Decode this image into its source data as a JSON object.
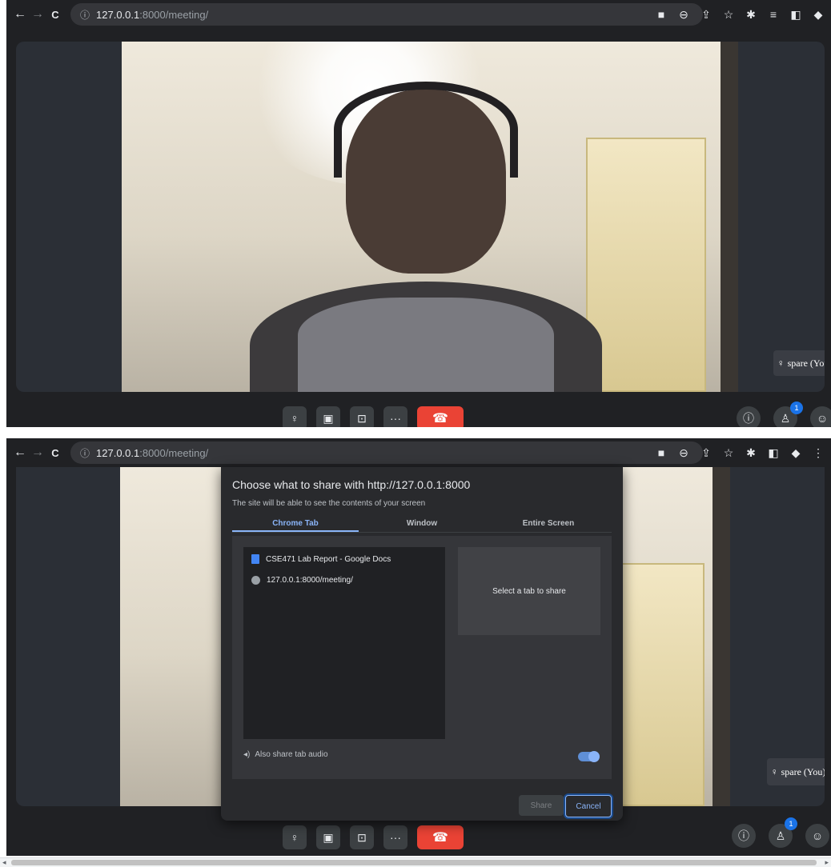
{
  "browser": {
    "url_host": "127.0.0.1",
    "url_rest": ":8000/meeting/"
  },
  "icons": {
    "back": "←",
    "forward": "→",
    "reload": "C",
    "info": "ⓘ",
    "camera": "■",
    "zoom": "⊖",
    "share": "⇪",
    "star": "☆",
    "extensions": "✱",
    "reading_list": "≡",
    "side_panel": "◧",
    "profile": "◆",
    "menu": "⋮",
    "mic": "♀",
    "video": "▣",
    "present": "⊡",
    "more": "···",
    "end_call": "☎",
    "meeting_info": "ⓘ",
    "people": "♙",
    "chat": "☺"
  },
  "meeting": {
    "self_label": "spare (You)",
    "participant_count": "1"
  },
  "dialog": {
    "title": "Choose what to share with http://127.0.0.1:8000",
    "subtitle": "The site will be able to see the contents of your screen",
    "tabs": [
      {
        "label": "Chrome Tab",
        "active": true
      },
      {
        "label": "Window",
        "active": false
      },
      {
        "label": "Entire Screen",
        "active": false
      }
    ],
    "items": [
      {
        "label": "CSE471 Lab Report - Google Docs",
        "icon": "docs-icon"
      },
      {
        "label": "127.0.0.1:8000/meeting/",
        "icon": "globe-icon"
      }
    ],
    "preview_text": "Select a tab to share",
    "audio_label": "Also share tab audio",
    "audio_enabled": true,
    "share_label": "Share",
    "cancel_label": "Cancel"
  },
  "colors": {
    "accent": "#8ab4f8",
    "end_call": "#ea4335",
    "badge": "#1a73e8"
  }
}
